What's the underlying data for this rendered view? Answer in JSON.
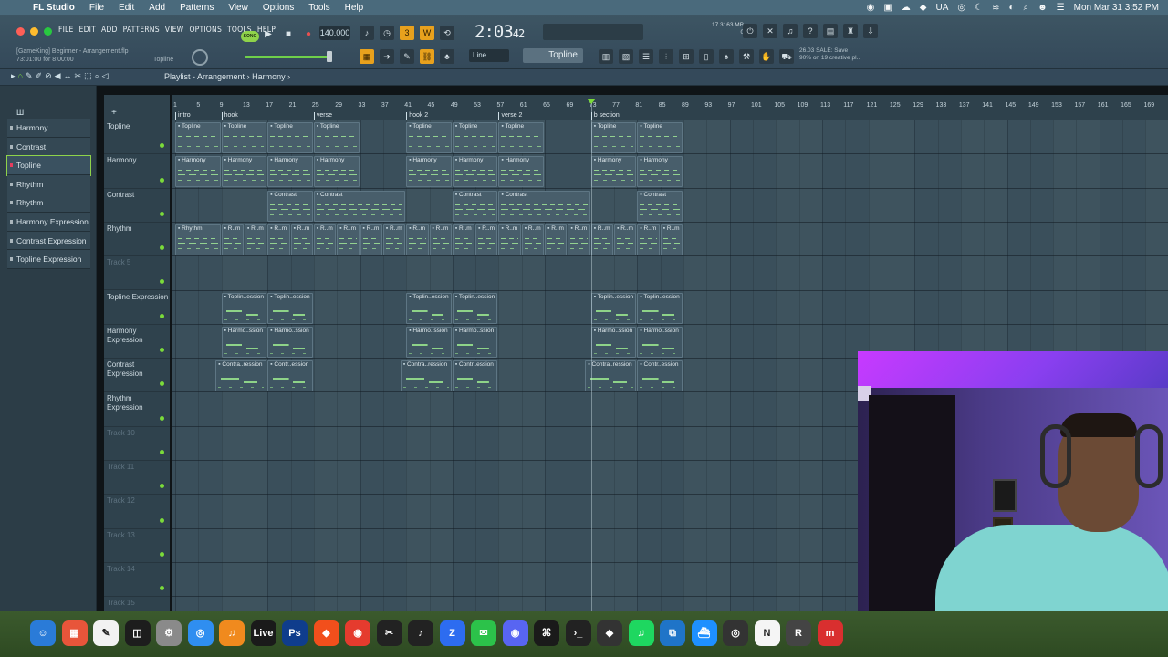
{
  "mac_menubar": {
    "app": "FL Studio",
    "items": [
      "File",
      "Edit",
      "Add",
      "Patterns",
      "View",
      "Options",
      "Tools",
      "Help"
    ],
    "locale": "UA",
    "datetime": "Mon Mar 31  3:52 PM"
  },
  "fl_menu": [
    "FILE",
    "EDIT",
    "ADD",
    "PATTERNS",
    "VIEW",
    "OPTIONS",
    "TOOLS",
    "HELP"
  ],
  "hint": {
    "line1": "[GameKing] Beginner - Arrangement.flp",
    "line2": "73:01:00 for 8:00:00",
    "right": "Topline"
  },
  "transport": {
    "mode": "SONG",
    "tempo": "140.000",
    "time_main": "2:03",
    "time_sub": "42",
    "memory_line1": "17   3163 MB",
    "memory_line2": "0",
    "snap": "Line",
    "pattern": "Topline"
  },
  "news": {
    "line1": "26.03  SALE: Save",
    "line2": "90% on 19 creative pl.."
  },
  "playlist": {
    "title": "Playlist - Arrangement",
    "breadcrumb_sep": "›",
    "current": "Harmony"
  },
  "picker": {
    "items": [
      {
        "label": "Harmony",
        "selected": false
      },
      {
        "label": "Contrast",
        "selected": false
      },
      {
        "label": "Topline",
        "selected": true
      },
      {
        "label": "Rhythm",
        "selected": false
      },
      {
        "label": "Rhythm",
        "selected": false
      },
      {
        "label": "Harmony Expression",
        "selected": false
      },
      {
        "label": "Contrast Expression",
        "selected": false
      },
      {
        "label": "Topline Expression",
        "selected": false
      }
    ]
  },
  "tracks": [
    {
      "name": "Topline",
      "dim": false
    },
    {
      "name": "Harmony",
      "dim": false
    },
    {
      "name": "Contrast",
      "dim": false
    },
    {
      "name": "Rhythm",
      "dim": false
    },
    {
      "name": "Track 5",
      "dim": true
    },
    {
      "name": "Topline Expression",
      "dim": false
    },
    {
      "name": "Harmony Expression",
      "dim": false
    },
    {
      "name": "Contrast Expression",
      "dim": false
    },
    {
      "name": "Rhythm Expression",
      "dim": false
    },
    {
      "name": "Track 10",
      "dim": true
    },
    {
      "name": "Track 11",
      "dim": true
    },
    {
      "name": "Track 12",
      "dim": true
    },
    {
      "name": "Track 13",
      "dim": true
    },
    {
      "name": "Track 14",
      "dim": true
    },
    {
      "name": "Track 15",
      "dim": true
    }
  ],
  "bar_numbers": [
    "1",
    "5",
    "9",
    "13",
    "17",
    "21",
    "25",
    "29",
    "33",
    "37",
    "41",
    "45",
    "49",
    "53",
    "57",
    "61",
    "65",
    "69",
    "73",
    "77",
    "81",
    "85",
    "89",
    "93",
    "97",
    "101",
    "105",
    "109",
    "113",
    "117",
    "121",
    "125",
    "129",
    "133",
    "137",
    "141",
    "145",
    "149",
    "153",
    "157",
    "161",
    "165",
    "169"
  ],
  "markers": [
    {
      "label": "intro",
      "bar": 1
    },
    {
      "label": "hook",
      "bar": 9
    },
    {
      "label": "verse",
      "bar": 25
    },
    {
      "label": "hook 2",
      "bar": 41
    },
    {
      "label": "verse 2",
      "bar": 57
    },
    {
      "label": "b section",
      "bar": 73
    }
  ],
  "clips": [
    {
      "track": 0,
      "label": "Topline",
      "start": 1,
      "len": 8
    },
    {
      "track": 0,
      "label": "Topline",
      "start": 9,
      "len": 8
    },
    {
      "track": 0,
      "label": "Topline",
      "start": 17,
      "len": 8
    },
    {
      "track": 0,
      "label": "Topline",
      "start": 25,
      "len": 8
    },
    {
      "track": 0,
      "label": "Topline",
      "start": 41,
      "len": 8
    },
    {
      "track": 0,
      "label": "Topline",
      "start": 49,
      "len": 8
    },
    {
      "track": 0,
      "label": "Topline",
      "start": 57,
      "len": 8
    },
    {
      "track": 0,
      "label": "Topline",
      "start": 73,
      "len": 8
    },
    {
      "track": 0,
      "label": "Topline",
      "start": 81,
      "len": 8
    },
    {
      "track": 1,
      "label": "Harmony",
      "start": 1,
      "len": 8
    },
    {
      "track": 1,
      "label": "Harmony",
      "start": 9,
      "len": 8
    },
    {
      "track": 1,
      "label": "Harmony",
      "start": 17,
      "len": 8
    },
    {
      "track": 1,
      "label": "Harmony",
      "start": 25,
      "len": 8
    },
    {
      "track": 1,
      "label": "Harmony",
      "start": 41,
      "len": 8
    },
    {
      "track": 1,
      "label": "Harmony",
      "start": 49,
      "len": 8
    },
    {
      "track": 1,
      "label": "Harmony",
      "start": 57,
      "len": 8
    },
    {
      "track": 1,
      "label": "Harmony",
      "start": 73,
      "len": 8
    },
    {
      "track": 1,
      "label": "Harmony",
      "start": 81,
      "len": 8
    },
    {
      "track": 2,
      "label": "Contrast",
      "start": 17,
      "len": 8
    },
    {
      "track": 2,
      "label": "Contrast",
      "start": 25,
      "len": 16
    },
    {
      "track": 2,
      "label": "Contrast",
      "start": 49,
      "len": 8
    },
    {
      "track": 2,
      "label": "Contrast",
      "start": 57,
      "len": 16
    },
    {
      "track": 2,
      "label": "Contrast",
      "start": 81,
      "len": 8
    },
    {
      "track": 3,
      "label": "Rhythm",
      "start": 1,
      "len": 8
    },
    {
      "track": 3,
      "label": "R..m",
      "start": 9,
      "len": 4
    },
    {
      "track": 3,
      "label": "R..m",
      "start": 13,
      "len": 4
    },
    {
      "track": 3,
      "label": "R..m",
      "start": 17,
      "len": 4
    },
    {
      "track": 3,
      "label": "R..m",
      "start": 21,
      "len": 4
    },
    {
      "track": 3,
      "label": "R..m",
      "start": 25,
      "len": 4
    },
    {
      "track": 3,
      "label": "R..m",
      "start": 29,
      "len": 4
    },
    {
      "track": 3,
      "label": "R..m",
      "start": 33,
      "len": 4
    },
    {
      "track": 3,
      "label": "R..m",
      "start": 37,
      "len": 4
    },
    {
      "track": 3,
      "label": "R..m",
      "start": 41,
      "len": 4
    },
    {
      "track": 3,
      "label": "R..m",
      "start": 45,
      "len": 4
    },
    {
      "track": 3,
      "label": "R..m",
      "start": 49,
      "len": 4
    },
    {
      "track": 3,
      "label": "R..m",
      "start": 53,
      "len": 4
    },
    {
      "track": 3,
      "label": "R..m",
      "start": 57,
      "len": 4
    },
    {
      "track": 3,
      "label": "R..m",
      "start": 61,
      "len": 4
    },
    {
      "track": 3,
      "label": "R..m",
      "start": 65,
      "len": 4
    },
    {
      "track": 3,
      "label": "R..m",
      "start": 69,
      "len": 4
    },
    {
      "track": 3,
      "label": "R..m",
      "start": 73,
      "len": 4
    },
    {
      "track": 3,
      "label": "R..m",
      "start": 77,
      "len": 4
    },
    {
      "track": 3,
      "label": "R..m",
      "start": 81,
      "len": 4
    },
    {
      "track": 3,
      "label": "R..m",
      "start": 85,
      "len": 4
    },
    {
      "track": 5,
      "label": "Toplin..ession",
      "start": 9,
      "len": 8,
      "auto": true
    },
    {
      "track": 5,
      "label": "Toplin..ession",
      "start": 17,
      "len": 8,
      "auto": true
    },
    {
      "track": 5,
      "label": "Toplin..ession",
      "start": 41,
      "len": 8,
      "auto": true
    },
    {
      "track": 5,
      "label": "Toplin..ession",
      "start": 49,
      "len": 8,
      "auto": true
    },
    {
      "track": 5,
      "label": "Toplin..ession",
      "start": 73,
      "len": 8,
      "auto": true
    },
    {
      "track": 5,
      "label": "Toplin..ession",
      "start": 81,
      "len": 8,
      "auto": true
    },
    {
      "track": 6,
      "label": "Harmo..ssion",
      "start": 9,
      "len": 8,
      "auto": true
    },
    {
      "track": 6,
      "label": "Harmo..ssion",
      "start": 17,
      "len": 8,
      "auto": true
    },
    {
      "track": 6,
      "label": "Harmo..ssion",
      "start": 41,
      "len": 8,
      "auto": true
    },
    {
      "track": 6,
      "label": "Harmo..ssion",
      "start": 49,
      "len": 8,
      "auto": true
    },
    {
      "track": 6,
      "label": "Harmo..ssion",
      "start": 73,
      "len": 8,
      "auto": true
    },
    {
      "track": 6,
      "label": "Harmo..ssion",
      "start": 81,
      "len": 8,
      "auto": true
    },
    {
      "track": 7,
      "label": "Contra..ression",
      "start": 8,
      "len": 9,
      "auto": true
    },
    {
      "track": 7,
      "label": "Contr..ession",
      "start": 17,
      "len": 8,
      "auto": true
    },
    {
      "track": 7,
      "label": "Contra..ression",
      "start": 40,
      "len": 9,
      "auto": true
    },
    {
      "track": 7,
      "label": "Contr..ession",
      "start": 49,
      "len": 8,
      "auto": true
    },
    {
      "track": 7,
      "label": "Contra..ression",
      "start": 72,
      "len": 9,
      "auto": true
    },
    {
      "track": 7,
      "label": "Contr..ession",
      "start": 81,
      "len": 8,
      "auto": true
    }
  ],
  "playhead_bar": 73,
  "dock_apps": [
    "Finder",
    "Launchpad",
    "Notes",
    "Activity Monitor",
    "Settings",
    "Safari",
    "FL Studio",
    "Live",
    "Ps",
    "Brave",
    "Chrome",
    "CapCut",
    "Logic",
    "Zoom",
    "Messages",
    "Discord",
    "Cursor",
    "Terminal",
    "Unity",
    "Spotify",
    "VS Code",
    "Docker",
    "OBS",
    "Notion",
    "R",
    "m"
  ],
  "colors": {
    "accent_green": "#7bdb3a",
    "orange": "#e8a11d",
    "selected_dot": "#e43d5e"
  }
}
